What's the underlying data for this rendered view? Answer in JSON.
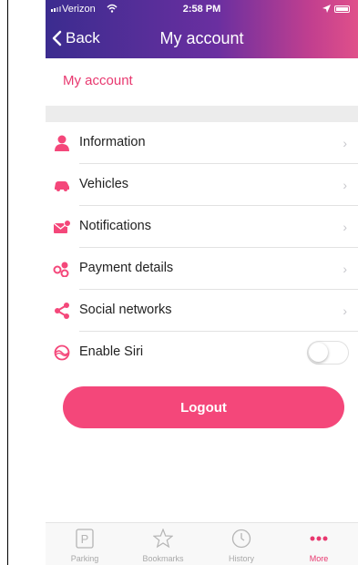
{
  "status_bar": {
    "carrier": "Verizon",
    "time": "2:58 PM"
  },
  "nav": {
    "back_label": "Back",
    "title": "My account"
  },
  "section": {
    "title": "My account"
  },
  "menu": {
    "items": [
      {
        "label": "Information",
        "icon": "person-icon"
      },
      {
        "label": "Vehicles",
        "icon": "car-icon"
      },
      {
        "label": "Notifications",
        "icon": "envelope-icon"
      },
      {
        "label": "Payment details",
        "icon": "coins-icon"
      },
      {
        "label": "Social networks",
        "icon": "share-icon"
      },
      {
        "label": "Enable Siri",
        "icon": "siri-icon",
        "toggle_on": false
      }
    ],
    "chevron": "›"
  },
  "logout": {
    "label": "Logout"
  },
  "tabs": [
    {
      "label": "Parking",
      "icon": "parking-icon",
      "active": false
    },
    {
      "label": "Bookmarks",
      "icon": "star-icon",
      "active": false
    },
    {
      "label": "History",
      "icon": "clock-icon",
      "active": false
    },
    {
      "label": "More",
      "icon": "more-icon",
      "active": true
    }
  ],
  "colors": {
    "accent": "#e8386f",
    "button": "#f4477a",
    "header_start": "#3b2c8f",
    "header_end": "#e0508a"
  }
}
